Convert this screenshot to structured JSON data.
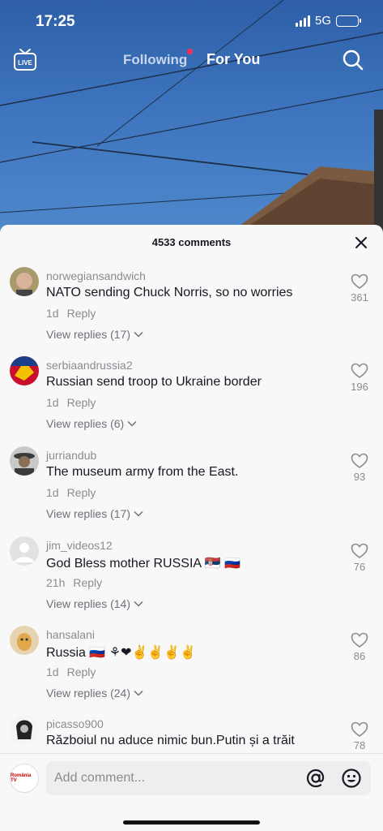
{
  "status_bar": {
    "time": "17:25",
    "network": "5G"
  },
  "top_nav": {
    "live_label": "LIVE",
    "tab_following": "Following",
    "tab_for_you": "For You"
  },
  "sheet": {
    "comment_count": "4533 comments"
  },
  "comments": [
    {
      "username": "norwegiansandwich",
      "text": "NATO sending Chuck Norris, so no worries",
      "time": "1d",
      "reply": "Reply",
      "view_replies": "View replies (17)",
      "likes": "361",
      "avatar_color": "#d8b29a"
    },
    {
      "username": "serbiaandrussia2",
      "text": "Russian send troop to Ukraine border",
      "time": "1d",
      "reply": "Reply",
      "view_replies": "View replies (6)",
      "likes": "196",
      "avatar_color": "#c8102e"
    },
    {
      "username": "jurriandub",
      "text": "The museum army from the East.",
      "time": "1d",
      "reply": "Reply",
      "view_replies": "View replies (17)",
      "likes": "93",
      "avatar_color": "#3b3b3b"
    },
    {
      "username": "jim_videos12",
      "text": "God Bless mother RUSSIA 🇷🇸 🇷🇺",
      "time": "21h",
      "reply": "Reply",
      "view_replies": "View replies (14)",
      "likes": "76",
      "avatar_color": "#e2e2e2"
    },
    {
      "username": "hansalani",
      "text": "Russia 🇷🇺 ⚘❤✌✌✌✌",
      "time": "1d",
      "reply": "Reply",
      "view_replies": "View replies (24)",
      "likes": "86",
      "avatar_color": "#e0c08a"
    },
    {
      "username": "picasso900",
      "text": "Războiul nu aduce nimic bun.Putin și a trăit",
      "time": "",
      "reply": "",
      "view_replies": "",
      "likes": "78",
      "avatar_color": "#222222"
    }
  ],
  "composer": {
    "placeholder": "Add comment...",
    "avatar_label": "România TV"
  },
  "colors": {
    "accent": "#fe2c55",
    "text_primary": "#161823",
    "text_secondary": "#8a8b91"
  },
  "icons": [
    "live-icon",
    "search-icon",
    "close-icon",
    "heart-icon",
    "chevron-down-icon",
    "at-icon",
    "emoji-icon"
  ]
}
